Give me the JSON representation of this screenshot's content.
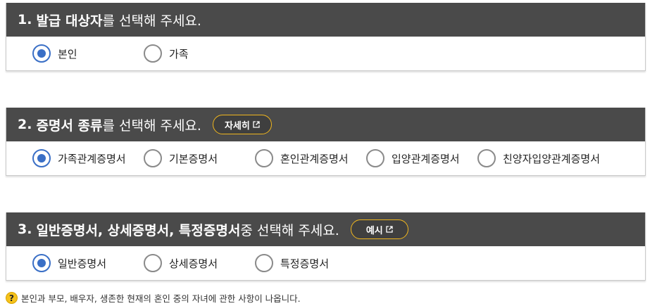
{
  "sections": [
    {
      "number": "1.",
      "title_bold": "발급 대상자",
      "title_normal": "를 선택해 주세요.",
      "options": [
        {
          "label": "본인",
          "checked": true
        },
        {
          "label": "가족",
          "checked": false
        }
      ]
    },
    {
      "number": "2.",
      "title_bold": "증명서 종류",
      "title_normal": "를 선택해 주세요.",
      "button_label": "자세히",
      "options": [
        {
          "label": "가족관계증명서",
          "checked": true
        },
        {
          "label": "기본증명서",
          "checked": false
        },
        {
          "label": "혼인관계증명서",
          "checked": false
        },
        {
          "label": "입양관계증명서",
          "checked": false
        },
        {
          "label": "친양자입양관계증명서",
          "checked": false
        }
      ]
    },
    {
      "number": "3.",
      "title_bold": "일반증명서, 상세증명서, 특정증명서",
      "title_normal": " 중 선택해 주세요.",
      "button_label": "예시",
      "options": [
        {
          "label": "일반증명서",
          "checked": true
        },
        {
          "label": "상세증명서",
          "checked": false
        },
        {
          "label": "특정증명서",
          "checked": false
        }
      ]
    }
  ],
  "note": {
    "icon": "question-icon",
    "text": "본인과 부모, 배우자, 생존한 현재의 혼인 중의 자녀에 관한 사항이 나옵니다."
  },
  "colors": {
    "header_bg": "#4a4a4a",
    "accent": "#3a6fc6",
    "button_border": "#f0b61e"
  }
}
